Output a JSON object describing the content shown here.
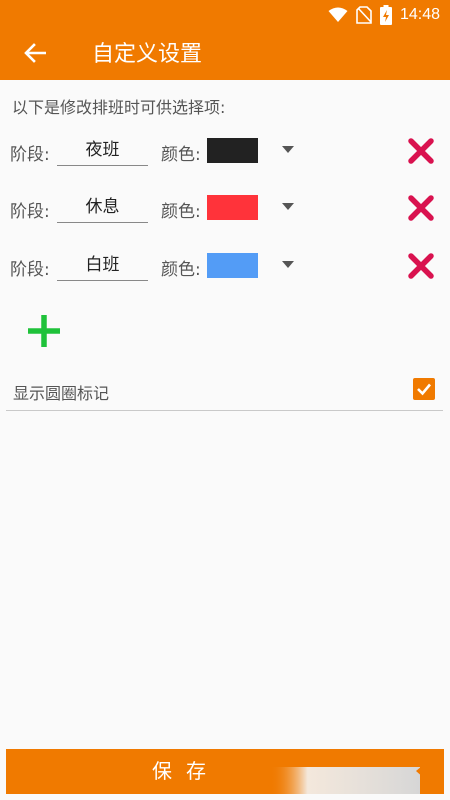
{
  "status_bar": {
    "time": "14:48"
  },
  "app_bar": {
    "title": "自定义设置"
  },
  "intro_text": "以下是修改排班时可供选择项:",
  "stage_label": "阶段:",
  "color_label": "颜色:",
  "stages": [
    {
      "name": "夜班",
      "color": "#222222"
    },
    {
      "name": "休息",
      "color": "#ff333a"
    },
    {
      "name": "白班",
      "color": "#539cf6"
    }
  ],
  "options": {
    "show_circle_label": "显示圆圈标记",
    "show_circle_checked": true
  },
  "save_label": "保存",
  "colors": {
    "accent": "#f07a00",
    "delete": "#d9124f",
    "add": "#1fc23a"
  }
}
